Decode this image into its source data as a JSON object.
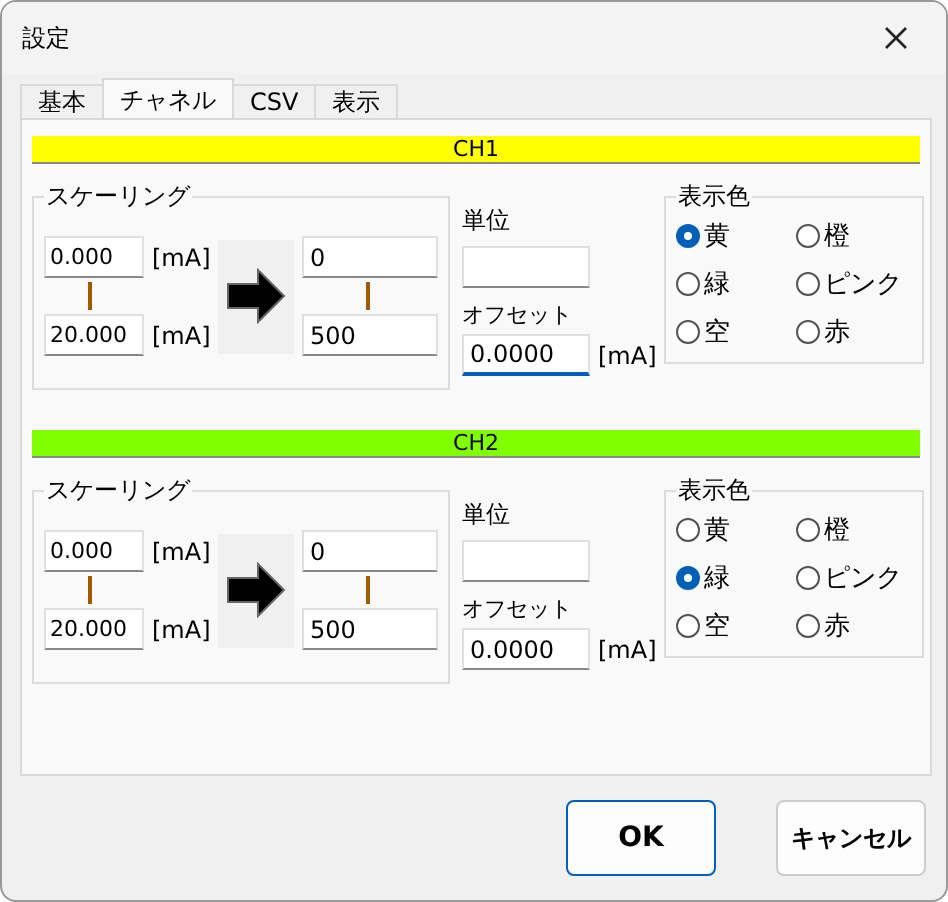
{
  "window": {
    "title": "設定"
  },
  "tabs": [
    {
      "label": "基本",
      "selected": false
    },
    {
      "label": "チャネル",
      "selected": true
    },
    {
      "label": "CSV",
      "selected": false
    },
    {
      "label": "表示",
      "selected": false
    }
  ],
  "channels": [
    {
      "name": "CH1",
      "color": "#ffff00",
      "scaling": {
        "title": "スケーリング",
        "in_min": "0.000",
        "in_max": "20.000",
        "in_unit_1": "[mA]",
        "in_unit_2": "[mA]",
        "out_min": "0",
        "out_max": "500"
      },
      "unit": {
        "label": "単位"
      },
      "offset": {
        "label": "オフセット",
        "value": "0.0000",
        "unit": "[mA]",
        "focused": true
      },
      "display_color": {
        "title": "表示色",
        "options": [
          {
            "label": "黄",
            "selected": true
          },
          {
            "label": "橙",
            "selected": false
          },
          {
            "label": "緑",
            "selected": false
          },
          {
            "label": "ピンク",
            "selected": false
          },
          {
            "label": "空",
            "selected": false
          },
          {
            "label": "赤",
            "selected": false
          }
        ]
      }
    },
    {
      "name": "CH2",
      "color": "#80ff00",
      "scaling": {
        "title": "スケーリング",
        "in_min": "0.000",
        "in_max": "20.000",
        "in_unit_1": "[mA]",
        "in_unit_2": "[mA]",
        "out_min": "0",
        "out_max": "500"
      },
      "unit": {
        "label": "単位"
      },
      "offset": {
        "label": "オフセット",
        "value": "0.0000",
        "unit": "[mA]",
        "focused": false
      },
      "display_color": {
        "title": "表示色",
        "options": [
          {
            "label": "黄",
            "selected": false
          },
          {
            "label": "橙",
            "selected": false
          },
          {
            "label": "緑",
            "selected": true
          },
          {
            "label": "ピンク",
            "selected": false
          },
          {
            "label": "空",
            "selected": false
          },
          {
            "label": "赤",
            "selected": false
          }
        ]
      }
    }
  ],
  "buttons": [
    {
      "label": "OK",
      "kind": "default"
    },
    {
      "label": "キャンセル",
      "kind": "normal"
    }
  ]
}
